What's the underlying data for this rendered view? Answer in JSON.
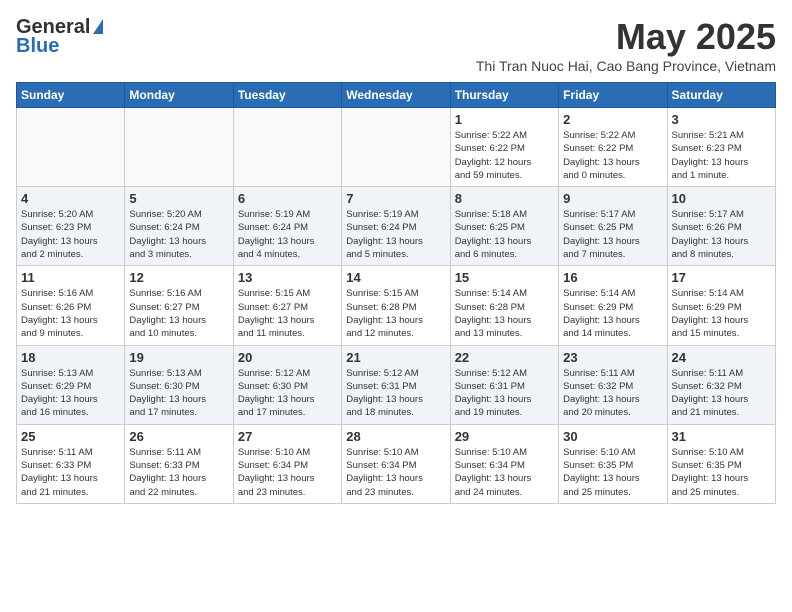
{
  "header": {
    "logo_general": "General",
    "logo_blue": "Blue",
    "title": "May 2025",
    "location": "Thi Tran Nuoc Hai, Cao Bang Province, Vietnam"
  },
  "days_of_week": [
    "Sunday",
    "Monday",
    "Tuesday",
    "Wednesday",
    "Thursday",
    "Friday",
    "Saturday"
  ],
  "weeks": [
    [
      {
        "day": "",
        "info": ""
      },
      {
        "day": "",
        "info": ""
      },
      {
        "day": "",
        "info": ""
      },
      {
        "day": "",
        "info": ""
      },
      {
        "day": "1",
        "info": "Sunrise: 5:22 AM\nSunset: 6:22 PM\nDaylight: 12 hours\nand 59 minutes."
      },
      {
        "day": "2",
        "info": "Sunrise: 5:22 AM\nSunset: 6:22 PM\nDaylight: 13 hours\nand 0 minutes."
      },
      {
        "day": "3",
        "info": "Sunrise: 5:21 AM\nSunset: 6:23 PM\nDaylight: 13 hours\nand 1 minute."
      }
    ],
    [
      {
        "day": "4",
        "info": "Sunrise: 5:20 AM\nSunset: 6:23 PM\nDaylight: 13 hours\nand 2 minutes."
      },
      {
        "day": "5",
        "info": "Sunrise: 5:20 AM\nSunset: 6:24 PM\nDaylight: 13 hours\nand 3 minutes."
      },
      {
        "day": "6",
        "info": "Sunrise: 5:19 AM\nSunset: 6:24 PM\nDaylight: 13 hours\nand 4 minutes."
      },
      {
        "day": "7",
        "info": "Sunrise: 5:19 AM\nSunset: 6:24 PM\nDaylight: 13 hours\nand 5 minutes."
      },
      {
        "day": "8",
        "info": "Sunrise: 5:18 AM\nSunset: 6:25 PM\nDaylight: 13 hours\nand 6 minutes."
      },
      {
        "day": "9",
        "info": "Sunrise: 5:17 AM\nSunset: 6:25 PM\nDaylight: 13 hours\nand 7 minutes."
      },
      {
        "day": "10",
        "info": "Sunrise: 5:17 AM\nSunset: 6:26 PM\nDaylight: 13 hours\nand 8 minutes."
      }
    ],
    [
      {
        "day": "11",
        "info": "Sunrise: 5:16 AM\nSunset: 6:26 PM\nDaylight: 13 hours\nand 9 minutes."
      },
      {
        "day": "12",
        "info": "Sunrise: 5:16 AM\nSunset: 6:27 PM\nDaylight: 13 hours\nand 10 minutes."
      },
      {
        "day": "13",
        "info": "Sunrise: 5:15 AM\nSunset: 6:27 PM\nDaylight: 13 hours\nand 11 minutes."
      },
      {
        "day": "14",
        "info": "Sunrise: 5:15 AM\nSunset: 6:28 PM\nDaylight: 13 hours\nand 12 minutes."
      },
      {
        "day": "15",
        "info": "Sunrise: 5:14 AM\nSunset: 6:28 PM\nDaylight: 13 hours\nand 13 minutes."
      },
      {
        "day": "16",
        "info": "Sunrise: 5:14 AM\nSunset: 6:29 PM\nDaylight: 13 hours\nand 14 minutes."
      },
      {
        "day": "17",
        "info": "Sunrise: 5:14 AM\nSunset: 6:29 PM\nDaylight: 13 hours\nand 15 minutes."
      }
    ],
    [
      {
        "day": "18",
        "info": "Sunrise: 5:13 AM\nSunset: 6:29 PM\nDaylight: 13 hours\nand 16 minutes."
      },
      {
        "day": "19",
        "info": "Sunrise: 5:13 AM\nSunset: 6:30 PM\nDaylight: 13 hours\nand 17 minutes."
      },
      {
        "day": "20",
        "info": "Sunrise: 5:12 AM\nSunset: 6:30 PM\nDaylight: 13 hours\nand 17 minutes."
      },
      {
        "day": "21",
        "info": "Sunrise: 5:12 AM\nSunset: 6:31 PM\nDaylight: 13 hours\nand 18 minutes."
      },
      {
        "day": "22",
        "info": "Sunrise: 5:12 AM\nSunset: 6:31 PM\nDaylight: 13 hours\nand 19 minutes."
      },
      {
        "day": "23",
        "info": "Sunrise: 5:11 AM\nSunset: 6:32 PM\nDaylight: 13 hours\nand 20 minutes."
      },
      {
        "day": "24",
        "info": "Sunrise: 5:11 AM\nSunset: 6:32 PM\nDaylight: 13 hours\nand 21 minutes."
      }
    ],
    [
      {
        "day": "25",
        "info": "Sunrise: 5:11 AM\nSunset: 6:33 PM\nDaylight: 13 hours\nand 21 minutes."
      },
      {
        "day": "26",
        "info": "Sunrise: 5:11 AM\nSunset: 6:33 PM\nDaylight: 13 hours\nand 22 minutes."
      },
      {
        "day": "27",
        "info": "Sunrise: 5:10 AM\nSunset: 6:34 PM\nDaylight: 13 hours\nand 23 minutes."
      },
      {
        "day": "28",
        "info": "Sunrise: 5:10 AM\nSunset: 6:34 PM\nDaylight: 13 hours\nand 23 minutes."
      },
      {
        "day": "29",
        "info": "Sunrise: 5:10 AM\nSunset: 6:34 PM\nDaylight: 13 hours\nand 24 minutes."
      },
      {
        "day": "30",
        "info": "Sunrise: 5:10 AM\nSunset: 6:35 PM\nDaylight: 13 hours\nand 25 minutes."
      },
      {
        "day": "31",
        "info": "Sunrise: 5:10 AM\nSunset: 6:35 PM\nDaylight: 13 hours\nand 25 minutes."
      }
    ]
  ]
}
